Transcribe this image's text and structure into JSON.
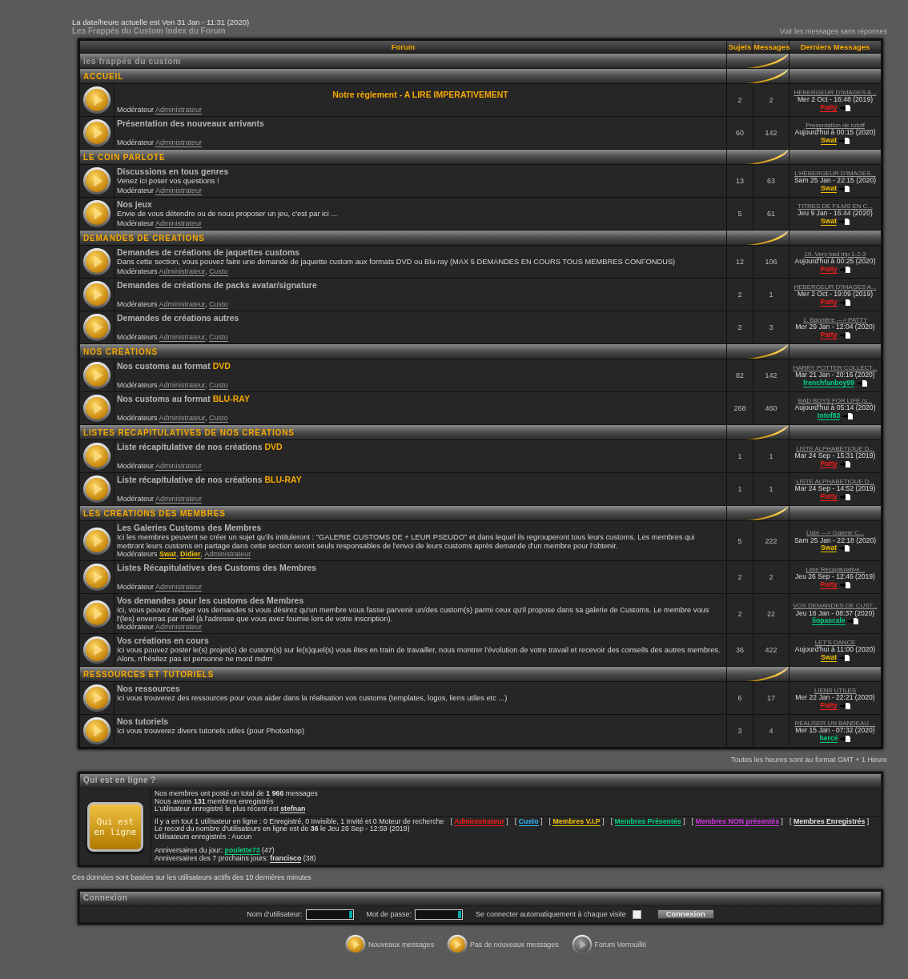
{
  "header": {
    "date_line": "La date/heure actuelle est Ven 31 Jan - 11:31 (2020)",
    "breadcrumb": "Les Frappés du Custom Index du Forum",
    "unanswered_link": "Voir les messages sans réponses"
  },
  "forum_table": {
    "columns": [
      "Forum",
      "Sujets",
      "Messages",
      "Derniers Messages"
    ],
    "site_category": "les frappés du custom",
    "categories": [
      {
        "title": "ACCUEIL",
        "forums": [
          {
            "kind": "notice",
            "title": "Notre règlement - A LIRE IMPERATIVEMENT",
            "moderator_label": "Modérateur",
            "moderators": [
              {
                "name": "Administrateur",
                "color": "#9a9a9a"
              }
            ],
            "topics": "2",
            "posts": "2",
            "last_post": {
              "title": "HEBERGEUR D'IMAGES A...",
              "date": "Mer 2 Oct - 16:48 (2019)",
              "user": "Patty",
              "color": "#ff1a1a"
            }
          },
          {
            "kind": "forum",
            "title": "Présentation des nouveaux arrivants",
            "moderator_label": "Modérateur",
            "moderators": [
              {
                "name": "Administrateur",
                "color": "#9a9a9a"
              }
            ],
            "topics": "60",
            "posts": "142",
            "last_post": {
              "title": "Presentation de totoff",
              "date": "Aujourd'hui à 00:15 (2020)",
              "user": "Swat",
              "color": "#f0c000"
            }
          }
        ]
      },
      {
        "title": "LE COIN PARLOTE",
        "forums": [
          {
            "kind": "forum",
            "title": "Discussions en tous genres",
            "description": "Venez ici poser vos questions !",
            "moderator_label": "Modérateur",
            "moderators": [
              {
                "name": "Administrateur",
                "color": "#9a9a9a"
              }
            ],
            "topics": "13",
            "posts": "63",
            "last_post": {
              "title": "L'HEBERGEUR D'IMAGES...",
              "date": "Sam 25 Jan - 22:15 (2020)",
              "user": "Swat",
              "color": "#f0c000"
            }
          },
          {
            "kind": "forum",
            "title": "Nos jeux",
            "description": "Envie de vous détendre ou de nous proposer un jeu, c'est par ici ...",
            "moderator_label": "Modérateur",
            "moderators": [
              {
                "name": "Administrateur",
                "color": "#9a9a9a"
              }
            ],
            "topics": "5",
            "posts": "61",
            "last_post": {
              "title": "TITRES DE FILMS EN C...",
              "date": "Jeu 9 Jan - 16:44 (2020)",
              "user": "Swat",
              "color": "#f0c000"
            }
          }
        ]
      },
      {
        "title": "DEMANDES DE CREATIONS",
        "forums": [
          {
            "kind": "forum",
            "title": "Demandes de créations de jaquettes customs",
            "description": "Dans cette section, vous pouvez faire une demande de jaquette custom aux formats DVD ou Blu-ray (MAX 5 DEMANDES EN COURS TOUS MEMBRES CONFONDUS)",
            "moderator_label": "Modérateurs",
            "moderators": [
              {
                "name": "Administrateur",
                "color": "#9a9a9a",
                "suffix": ","
              },
              {
                "name": "Custo",
                "color": "#9a9a9a"
              }
            ],
            "topics": "12",
            "posts": "106",
            "last_post": {
              "title": "10. Very bad trip 1-2-3",
              "date": "Aujourd'hui à 00:25 (2020)",
              "user": "Patty",
              "color": "#ff1a1a"
            }
          },
          {
            "kind": "forum",
            "title": "Demandes de créations de packs avatar/signature",
            "moderator_label": "Modérateurs",
            "moderators": [
              {
                "name": "Administrateur",
                "color": "#9a9a9a",
                "suffix": ","
              },
              {
                "name": "Custo",
                "color": "#9a9a9a"
              }
            ],
            "topics": "2",
            "posts": "1",
            "last_post": {
              "title": "HEBERGEUR D'IMAGES A...",
              "date": "Mer 2 Oct - 19:09 (2019)",
              "user": "Patty",
              "color": "#ff1a1a"
            }
          },
          {
            "kind": "forum",
            "title": "Demandes de créations autres",
            "moderator_label": "Modérateurs",
            "moderators": [
              {
                "name": "Administrateur",
                "color": "#9a9a9a",
                "suffix": ","
              },
              {
                "name": "Custo",
                "color": "#9a9a9a"
              }
            ],
            "topics": "2",
            "posts": "3",
            "last_post": {
              "title": "1. Bannière ---> PATTY",
              "date": "Mer 29 Jan - 12:04 (2020)",
              "user": "Patty",
              "color": "#ff1a1a"
            }
          }
        ]
      },
      {
        "title": "NOS CREATIONS",
        "forums": [
          {
            "kind": "forum",
            "title": "Nos customs au format",
            "highlight": "DVD",
            "moderator_label": "Modérateurs",
            "moderators": [
              {
                "name": "Administrateur",
                "color": "#9a9a9a",
                "suffix": ","
              },
              {
                "name": "Custo",
                "color": "#9a9a9a"
              }
            ],
            "topics": "82",
            "posts": "142",
            "last_post": {
              "title": "HARRY POTTER COLLECT...",
              "date": "Mar 21 Jan - 20:16 (2020)",
              "user": "frenchfanboy99",
              "color": "#00d080"
            }
          },
          {
            "kind": "forum",
            "title": "Nos customs au format",
            "highlight": "BLU-RAY",
            "moderator_label": "Modérateurs",
            "moderators": [
              {
                "name": "Administrateur",
                "color": "#9a9a9a",
                "suffix": ","
              },
              {
                "name": "Custo",
                "color": "#9a9a9a"
              }
            ],
            "topics": "268",
            "posts": "460",
            "last_post": {
              "title": "BAD BOYS FOR LIFE (s...",
              "date": "Aujourd'hui à 05:14 (2020)",
              "user": "totof83",
              "color": "#00d080"
            }
          }
        ]
      },
      {
        "title": "LISTES RECAPITULATIVES DE NOS CREATIONS",
        "forums": [
          {
            "kind": "forum",
            "title": "Liste récapitulative de nos créations",
            "highlight": "DVD",
            "moderator_label": "Modérateur",
            "moderators": [
              {
                "name": "Administrateur",
                "color": "#9a9a9a"
              }
            ],
            "topics": "1",
            "posts": "1",
            "last_post": {
              "title": "LISTE ALPHABETIQUE D...",
              "date": "Mar 24 Sep - 15:31 (2019)",
              "user": "Patty",
              "color": "#ff1a1a"
            }
          },
          {
            "kind": "forum",
            "title": "Liste récapitulative de nos créations",
            "highlight": "BLU-RAY",
            "moderator_label": "Modérateur",
            "moderators": [
              {
                "name": "Administrateur",
                "color": "#9a9a9a"
              }
            ],
            "topics": "1",
            "posts": "1",
            "last_post": {
              "title": "LISTE ALPHABETIQUE D...",
              "date": "Mar 24 Sep - 14:52 (2019)",
              "user": "Patty",
              "color": "#ff1a1a"
            }
          }
        ]
      },
      {
        "title": "LES CREATIONS DES MEMBRES",
        "forums": [
          {
            "kind": "forum",
            "title": "Les Galeries Customs des Membres",
            "description": "Ici les membres peuvent se créer un sujet qu'ils intituleront : \"GALERIE CUSTOMS DE + LEUR PSEUDO\" et dans lequel ils regrouperont tous leurs customs. Les membres qui mettront leurs customs en partage dans cette section seront seuls responsables de l'envoi de leurs customs après demande d'un membre pour l'obtenir.",
            "moderator_label": "Modérateurs",
            "moderators": [
              {
                "name": "Swat",
                "color": "#f0c000",
                "suffix": ","
              },
              {
                "name": "Didier",
                "color": "#f0c000",
                "suffix": ","
              },
              {
                "name": "Administrateur",
                "color": "#9a9a9a"
              }
            ],
            "topics": "5",
            "posts": "222",
            "last_post": {
              "title": "Listé ---> Galerie C...",
              "date": "Sam 25 Jan - 22:18 (2020)",
              "user": "Swat",
              "color": "#f0c000"
            }
          },
          {
            "kind": "forum",
            "title": "Listes Récapitulatives des Customs des Membres",
            "moderator_label": "Modérateur",
            "moderators": [
              {
                "name": "Administrateur",
                "color": "#9a9a9a"
              }
            ],
            "topics": "2",
            "posts": "2",
            "last_post": {
              "title": "Liste Récapitulative...",
              "date": "Jeu 26 Sep - 12:46 (2019)",
              "user": "Patty",
              "color": "#ff1a1a"
            }
          },
          {
            "kind": "forum",
            "title": "Vos demandes pour les customs des Membres",
            "description": "Ici, vous pouvez rédiger vos demandes si vous désirez qu'un membre vous fasse parvenir un/des custom(s) parmi ceux qu'il propose dans sa galerie de Customs. Le membre vous l'(les) enverras par mail (à l'adresse que vous avez fournie lors de votre inscription).",
            "moderator_label": "Modérateur",
            "moderators": [
              {
                "name": "Administrateur",
                "color": "#9a9a9a"
              }
            ],
            "topics": "2",
            "posts": "22",
            "last_post": {
              "title": "VOS DEMANDES DE CUST...",
              "date": "Jeu 16 Jan - 08:37 (2020)",
              "user": "liopascale",
              "color": "#00d080"
            }
          },
          {
            "kind": "forum",
            "title": "Vos créations en cours",
            "description": "Ici vous pouvez poster le(s) projet(s) de custom(s) sur le(s)quel(s) vous êtes en train de travailler, nous montrer l'évolution de votre travail et recevoir des conseils des autres membres. Alors, n'hésitez pas ici personne ne mord mdrrr",
            "topics": "36",
            "posts": "422",
            "last_post": {
              "title": "LET'S DANCE",
              "date": "Aujourd'hui à 11:00 (2020)",
              "user": "Swat",
              "color": "#f0c000"
            }
          }
        ]
      },
      {
        "title": "RESSOURCES ET TUTORIELS",
        "forums": [
          {
            "kind": "forum",
            "title": "Nos ressources",
            "description": "Ici vous trouverez des ressources pour vous aider dans la réalisation vos customs (templates, logos, liens utiles etc ...)",
            "topics": "6",
            "posts": "17",
            "last_post": {
              "title": "LIENS UTILES",
              "date": "Mer 22 Jan - 22:21 (2020)",
              "user": "Patty",
              "color": "#ff1a1a"
            }
          },
          {
            "kind": "forum",
            "title": "Nos tutoriels",
            "description": "Ici vous trouverez divers tutoriels utiles (pour Photoshop)",
            "topics": "3",
            "posts": "4",
            "last_post": {
              "title": "REALISER UN BANDEAU ...",
              "date": "Mer 15 Jan - 07:32 (2020)",
              "user": "hercé",
              "color": "#00d080"
            }
          }
        ]
      }
    ]
  },
  "timezone_note": "Toutes les heures sont au format GMT + 1 Heure",
  "who_is_online": {
    "title": "Qui est en ligne ?",
    "badge": "Qui est en ligne",
    "stats": [
      "Nos membres ont posté un total de **1 966** messages",
      "Nous avons **131** membres enregistrés"
    ],
    "newest_user": {
      "text": "L'utilisateur enregistré le plus récent est",
      "user": "stefnan"
    },
    "online_line": "Il y a en tout 1 utilisateur en ligne : 0 Enregistré, 0 Invisible, 1 Invité et 0 Moteur de recherche",
    "groups": [
      {
        "open": "[",
        "name": "Administrateur",
        "close": "]",
        "color": "#ff1a1a"
      },
      {
        "open": "[",
        "name": "Custo",
        "close": "]",
        "color": "#33bbff"
      },
      {
        "open": "[",
        "name": "Membres V.I.P",
        "close": "]",
        "color": "#f0c000"
      },
      {
        "open": "[",
        "name": "Membres Présentés",
        "close": "]",
        "color": "#00d080"
      },
      {
        "open": "[",
        "name": "Membres NON présentés",
        "close": "]",
        "color": "#cc33dd"
      },
      {
        "open": "[",
        "name": "Membres Enregistrés",
        "close": "]",
        "color": "#dddddd"
      }
    ],
    "record_line": "Le record du nombre d'utilisateurs en ligne est de **36** le Jeu 26 Sep - 12:59 (2019)",
    "registered_line": "Utilisateurs enregistrés : Aucun",
    "birthdays": [
      {
        "label": "Anniversaires du jour:",
        "user": "poulette73",
        "color": "#00d080",
        "age": "(47)"
      },
      {
        "label": "Anniversaires des 7 prochains jours:",
        "user": "francisco",
        "color": "#dddddd",
        "age": "(38)"
      }
    ]
  },
  "activity_note": "Ces données sont basées sur les utilisateurs actifs des 10 dernières minutes",
  "login": {
    "title": "Connexion",
    "username_label": "Nom d'utilisateur:",
    "password_label": "Mot de passe:",
    "autologin_label": "Se connecter automatiquement à chaque visite",
    "autologin_checked": false,
    "button": "Connexion"
  },
  "legend": [
    {
      "kind": "new",
      "label": "Nouveaux messages"
    },
    {
      "kind": "none",
      "label": "Pas de nouveaux messages"
    },
    {
      "kind": "locked",
      "label": "Forum Verrouillé"
    }
  ]
}
